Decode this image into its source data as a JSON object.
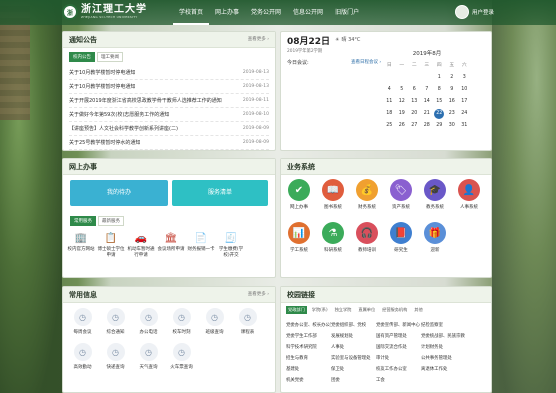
{
  "header": {
    "logo_mark": "浙",
    "logo_text": "浙江理工大学",
    "logo_sub": "ZHEJIANG SCI-TECH UNIVERSITY",
    "nav": [
      "学校首页",
      "网上办事",
      "党务公开网",
      "信息公开网",
      "旧版门户"
    ],
    "user_label": "用户登录"
  },
  "notice": {
    "title": "通知公告",
    "more": "查看更多 ›",
    "tabs": [
      "校内公告",
      "理工要闻"
    ],
    "items": [
      {
        "text": "关于10月教学楼暂时停电通知",
        "date": "2019-08-13"
      },
      {
        "text": "关于10月教学楼暂时停电通知",
        "date": "2019-08-13"
      },
      {
        "text": "关于开展2019年度浙江省高校思政教学骨干教师人选推荐工作的通知",
        "date": "2019-08-11"
      },
      {
        "text": "关于做好今年第59次(校)志愿服务工作的通知",
        "date": "2019-08-10"
      },
      {
        "text": "【讲座预告】人文社会科学教学创新系列讲座(二)",
        "date": "2019-08-09"
      },
      {
        "text": "关于25号教学楼暂时停水的通知",
        "date": "2019-08-09"
      }
    ]
  },
  "date_panel": {
    "date": "08月22日",
    "sub": "2019学年第2学期",
    "weather": "晴 34°C",
    "meeting": "今日会议:",
    "meeting_more": "查看日程会议 ›",
    "cal_title": "2019年8月",
    "weekdays": [
      "日",
      "一",
      "二",
      "三",
      "四",
      "五",
      "六"
    ],
    "days": [
      "",
      "",
      "",
      "",
      "1",
      "2",
      "3",
      "4",
      "5",
      "6",
      "7",
      "8",
      "9",
      "10",
      "11",
      "12",
      "13",
      "14",
      "15",
      "16",
      "17",
      "18",
      "19",
      "20",
      "21",
      "22",
      "23",
      "24",
      "25",
      "26",
      "27",
      "28",
      "29",
      "30",
      "31"
    ],
    "today": "22"
  },
  "online": {
    "title": "网上办事",
    "btn1": "我的待办",
    "btn2": "服务清单",
    "tabs": [
      "常用服务",
      "最新服务"
    ],
    "services": [
      {
        "label": "校内官方网站",
        "icon": "🏢",
        "color": "#d9534f"
      },
      {
        "label": "博士硕士学位申请",
        "icon": "📋",
        "color": "#d98a2f"
      },
      {
        "label": "机动车暂时通行申请",
        "icon": "🚗",
        "color": "#c0392b"
      },
      {
        "label": "会议场所申请",
        "icon": "🏛",
        "color": "#c0392b"
      },
      {
        "label": "财务报销一卡",
        "icon": "📄",
        "color": "#d98a2f"
      },
      {
        "label": "学生缴费(学校)开交",
        "icon": "🧾",
        "color": "#d98a2f"
      }
    ]
  },
  "business": {
    "title": "业务系统",
    "items": [
      {
        "label": "网上办事",
        "icon": "✔",
        "color": "#3bab5a"
      },
      {
        "label": "图书系统",
        "icon": "📖",
        "color": "#e05d3d"
      },
      {
        "label": "财务系统",
        "icon": "💰",
        "color": "#f0a030"
      },
      {
        "label": "资产系统",
        "icon": "🏷",
        "color": "#8a60d0"
      },
      {
        "label": "教务系统",
        "icon": "🎓",
        "color": "#6a58c8"
      },
      {
        "label": "人事系统",
        "icon": "👤",
        "color": "#d9534f"
      },
      {
        "label": "学工系统",
        "icon": "📊",
        "color": "#e07030"
      },
      {
        "label": "科研系统",
        "icon": "⚗",
        "color": "#3bab5a"
      },
      {
        "label": "教师培训",
        "icon": "🎧",
        "color": "#d94f5c"
      },
      {
        "label": "研究生",
        "icon": "📕",
        "color": "#3f7fd0"
      },
      {
        "label": "迎新",
        "icon": "🎁",
        "color": "#5a8fd8"
      }
    ]
  },
  "common": {
    "title": "常用信息",
    "more": "查看更多 ›",
    "items": [
      "每周会议",
      "综合通知",
      "办公电话",
      "校车时刻",
      "班级查询",
      "课程表",
      "高效勤动",
      "快递查询",
      "天气查询",
      "火车票查询"
    ]
  },
  "links": {
    "title": "校园链接",
    "tabs": [
      "党政部门",
      "学院(系)",
      "独立学院",
      "直属单位",
      "经营服务机构",
      "其他"
    ],
    "items": [
      "党委办公室、校长办公室",
      "党委组织部、党校",
      "党委宣传部、新闻中心",
      "纪检监察室",
      "党委学生工作部",
      "发展规划处",
      "国有资产管理处",
      "党委统战部、民族宗教",
      "科学技术研究院",
      "人事处",
      "国际交流合作处",
      "计划财务处",
      "招生与教育",
      "实验室与设备管理处",
      "审计处",
      "公共事务管理处",
      "基建处",
      "保卫处",
      "校友工作办公室",
      "离退休工作处",
      "机关党委",
      "团委",
      "工会"
    ]
  },
  "colors": {
    "primary_green": "#2f8a4a",
    "btn_blue": "#3ab1d2",
    "btn_teal": "#2ec0c4",
    "calendar_today": "#2c6fb0"
  }
}
